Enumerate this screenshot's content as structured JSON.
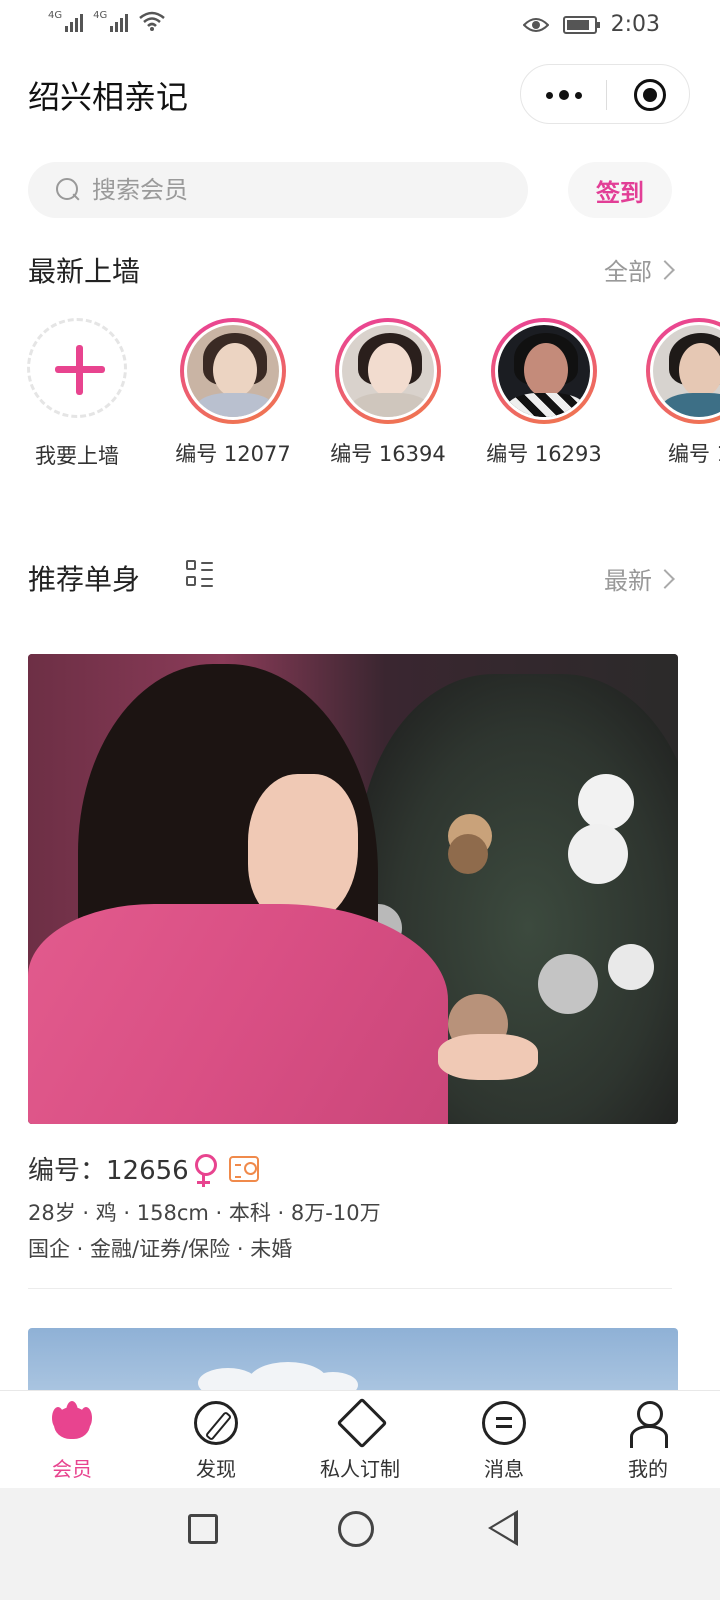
{
  "status_bar": {
    "signal1_label": "4G",
    "signal2_label": "4G",
    "time": "2:03"
  },
  "header": {
    "title": "绍兴相亲记"
  },
  "search": {
    "placeholder": "搜索会员",
    "checkin_label": "签到"
  },
  "latest_wall": {
    "title": "最新上墙",
    "more_label": "全部",
    "add_label": "我要上墙",
    "items": [
      {
        "label": "编号 12077"
      },
      {
        "label": "编号 16394"
      },
      {
        "label": "编号 16293"
      },
      {
        "label": "编号 1"
      }
    ]
  },
  "recommend": {
    "title": "推荐单身",
    "sort_label": "最新"
  },
  "card": {
    "number_line": "编号：12656",
    "meta1": "28岁 · 鸡 · 158cm · 本科 · 8万-10万",
    "meta2": "国企 · 金融/证券/保险 · 未婚"
  },
  "tabbar": {
    "items": [
      {
        "label": "会员",
        "icon": "lotus-icon",
        "active": true
      },
      {
        "label": "发现",
        "icon": "compass-icon",
        "active": false
      },
      {
        "label": "私人订制",
        "icon": "diamond-icon",
        "active": false
      },
      {
        "label": "消息",
        "icon": "chat-icon",
        "active": false
      },
      {
        "label": "我的",
        "icon": "user-icon",
        "active": false
      }
    ]
  },
  "colors": {
    "accent": "#e8448f",
    "accent_orange": "#f08a4b"
  }
}
